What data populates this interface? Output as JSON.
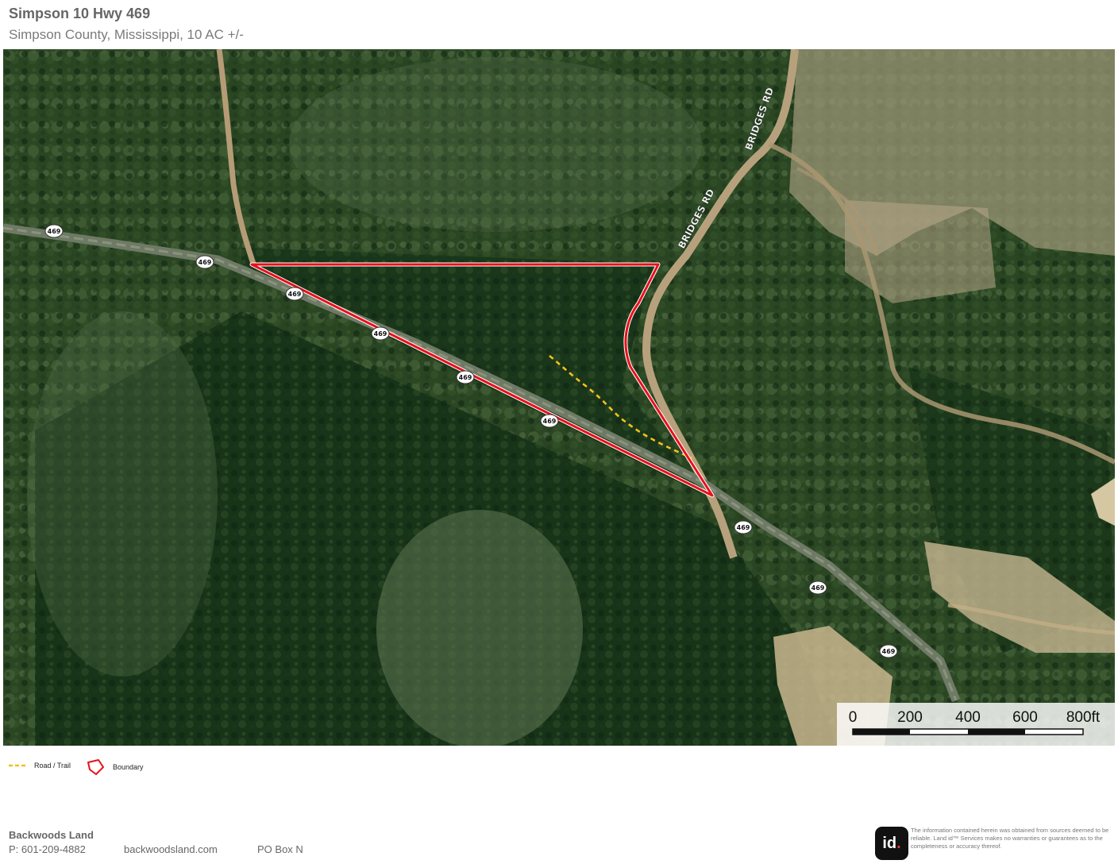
{
  "header": {
    "title": "Simpson 10 Hwy 469",
    "subtitle": "Simpson County, Mississippi, 10 AC +/-"
  },
  "map": {
    "road_labels": {
      "bridges_rd": "BRIDGES RD",
      "hwy_shield": "469"
    },
    "scale_bar": {
      "ticks": [
        "0",
        "200",
        "400",
        "600",
        "800ft"
      ]
    }
  },
  "legend": {
    "road_trail": {
      "label": "Road / Trail",
      "color": "#f2c11c"
    },
    "boundary": {
      "label": "Boundary",
      "color": "#e8101a"
    }
  },
  "footer": {
    "company": "Backwoods Land",
    "phone": "P: 601-209-4882",
    "website": "backwoodsland.com",
    "address": "PO Box N",
    "logo_text": "id",
    "logo_dot": ".",
    "disclaimer": "The information contained herein was obtained from sources deemed to be reliable. Land id™ Services makes no warranties or guarantees as to the completeness or accuracy thereof."
  },
  "colors": {
    "forest_dark": "#173318",
    "forest_mid": "#2c4a24",
    "clearing": "#b8a88a"
  }
}
